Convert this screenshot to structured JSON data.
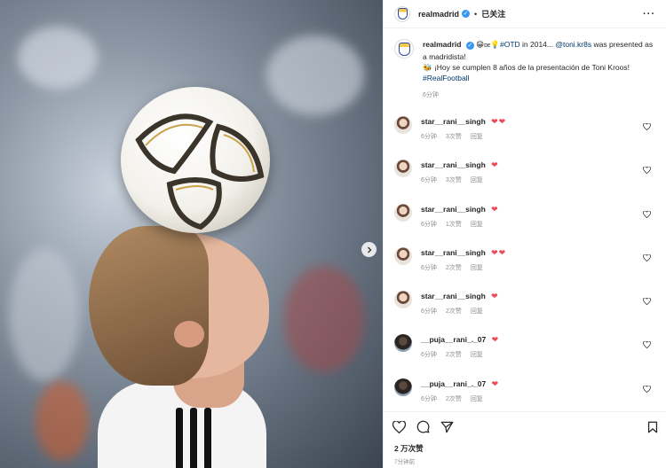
{
  "header": {
    "username": "realmadrid",
    "verified_mark": "✓",
    "separator": "•",
    "follow_label": "已关注",
    "more_label": "···"
  },
  "caption": {
    "username": "realmadrid",
    "emoji_1": "😁",
    "emoji_2": "ᴅᴇ",
    "emoji_3": "💡",
    "hashtag_otd": "#OTD",
    "text_1": " in 2014... ",
    "mention": "@toni.kr8s",
    "text_2": " was presented as a madridista!",
    "emoji_flag": "🐝",
    "text_3": " ¡Hoy se cumplen 8 años de la presentación de Toni Kroos!",
    "hashtag_rf": "#RealFootball",
    "time": "6分钟"
  },
  "comments": [
    {
      "name": "star__rani__singh",
      "hearts": "❤❤",
      "time": "6分钟",
      "likes": "3次赞",
      "reply": "回复"
    },
    {
      "name": "star__rani__singh",
      "hearts": "❤",
      "time": "6分钟",
      "likes": "3次赞",
      "reply": "回复"
    },
    {
      "name": "star__rani__singh",
      "hearts": "❤",
      "time": "6分钟",
      "likes": "1次赞",
      "reply": "回复"
    },
    {
      "name": "star__rani__singh",
      "hearts": "❤❤",
      "time": "6分钟",
      "likes": "2次赞",
      "reply": "回复"
    },
    {
      "name": "star__rani__singh",
      "hearts": "❤",
      "time": "6分钟",
      "likes": "2次赞",
      "reply": "回复"
    },
    {
      "name": "__puja__rani_._07",
      "hearts": "❤",
      "time": "6分钟",
      "likes": "2次赞",
      "reply": "回复"
    },
    {
      "name": "__puja__rani_._07",
      "hearts": "❤",
      "time": "6分钟",
      "likes": "2次赞",
      "reply": "回复"
    }
  ],
  "footer": {
    "likes_count": "2 万次赞",
    "posted_time": "7分钟前"
  },
  "icons": {
    "like": "heart-icon",
    "comment": "comment-bubble-icon",
    "share": "paper-plane-icon",
    "save": "bookmark-icon",
    "next": "chevron-right-icon"
  },
  "colors": {
    "heart": "#ed4956",
    "link": "#00376b",
    "verified": "#3897f0",
    "muted": "#8e8e8e"
  }
}
